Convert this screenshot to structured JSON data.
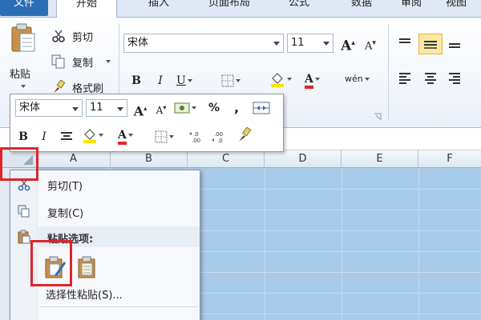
{
  "tabs": [
    {
      "label": "文件"
    },
    {
      "label": "开始"
    },
    {
      "label": "插入"
    },
    {
      "label": "页面布局"
    },
    {
      "label": "公式"
    },
    {
      "label": "数据"
    },
    {
      "label": "审阅"
    },
    {
      "label": "视图"
    }
  ],
  "ribbon": {
    "paste_label": "粘贴",
    "cut_label": "剪切",
    "copy_label": "复制",
    "format_painter_label": "格式刷",
    "font_name": "宋体",
    "font_size": "11",
    "grow_font": "A",
    "shrink_font": "A",
    "bold": "B",
    "italic": "I",
    "underline": "U",
    "font_color": "A",
    "phonetic": "wén"
  },
  "minibar": {
    "font_name": "宋体",
    "font_size": "11",
    "percent": "%",
    "comma": ",",
    "bold": "B",
    "italic": "I",
    "font_color": "A"
  },
  "columns": [
    "A",
    "B",
    "C",
    "D",
    "E",
    "F"
  ],
  "context_menu": {
    "cut_label": "剪切(T)",
    "copy_label": "复制(C)",
    "paste_options_label": "粘贴选项:",
    "paste_special_label": "选择性粘贴(S)..."
  },
  "colors": {
    "selection": "#a9cbea",
    "file_tab": "#2a6fb5",
    "highlight_red": "#e0242a",
    "font_color_bar": "#e0242a",
    "fill_color_bar": "#ffe100"
  }
}
